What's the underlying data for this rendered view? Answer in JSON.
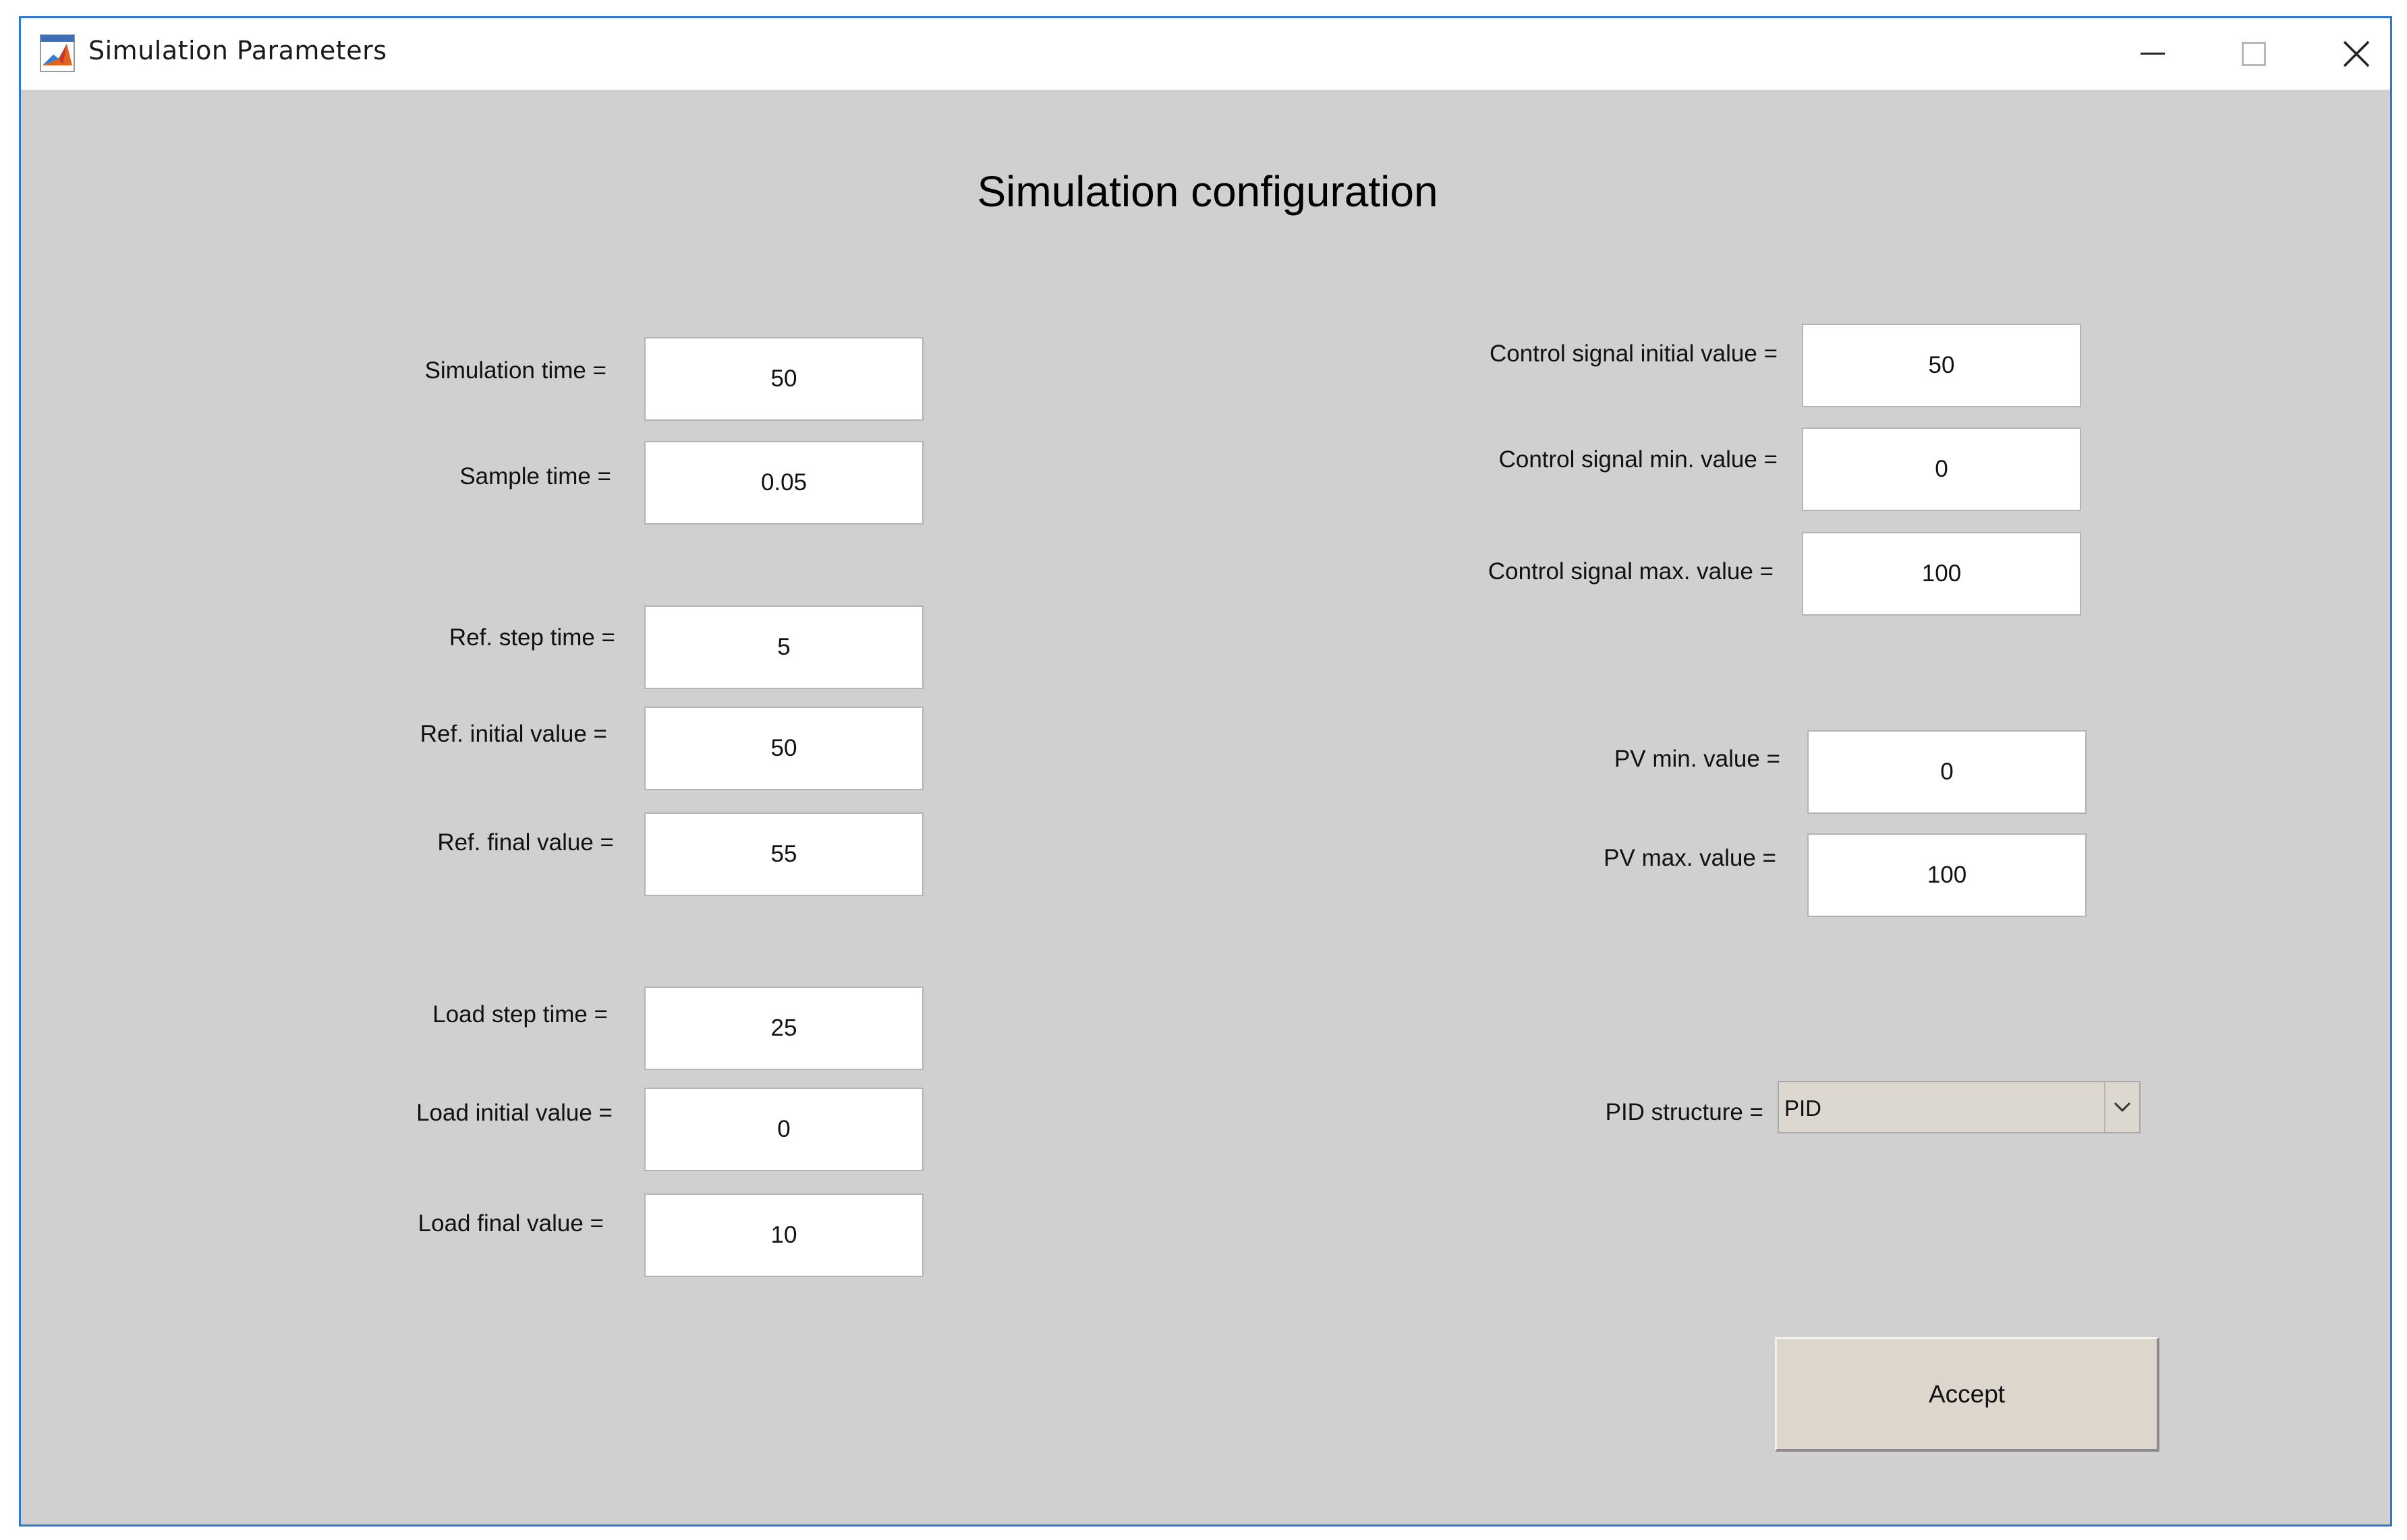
{
  "window": {
    "title": "Simulation Parameters",
    "app_icon": "matlab-logo-icon",
    "minimize_icon": "minimize-icon",
    "maximize_icon": "maximize-icon",
    "close_icon": "close-icon"
  },
  "heading": "Simulation configuration",
  "left_fields": {
    "simulation_time": {
      "label": "Simulation time =",
      "value": "50"
    },
    "sample_time": {
      "label": "Sample time =",
      "value": "0.05"
    },
    "ref_step_time": {
      "label": "Ref. step time =",
      "value": "5"
    },
    "ref_initial_value": {
      "label": "Ref. initial value =",
      "value": "50"
    },
    "ref_final_value": {
      "label": "Ref. final value =",
      "value": "55"
    },
    "load_step_time": {
      "label": "Load step time =",
      "value": "25"
    },
    "load_initial_value": {
      "label": "Load initial value =",
      "value": "0"
    },
    "load_final_value": {
      "label": "Load final value =",
      "value": "10"
    }
  },
  "right_fields": {
    "control_initial": {
      "label": "Control signal initial value =",
      "value": "50"
    },
    "control_min": {
      "label": "Control signal min. value =",
      "value": "0"
    },
    "control_max": {
      "label": "Control signal max. value =",
      "value": "100"
    },
    "pv_min": {
      "label": "PV min. value =",
      "value": "0"
    },
    "pv_max": {
      "label": "PV max. value =",
      "value": "100"
    }
  },
  "pid_structure": {
    "label": "PID structure =",
    "selected": "PID",
    "icon": "chevron-down-icon"
  },
  "accept_button": {
    "label": "Accept"
  },
  "colors": {
    "window_border": "#2b79d4",
    "panel_background": "#d0d0d0",
    "button_face": "#ddd6cd"
  }
}
